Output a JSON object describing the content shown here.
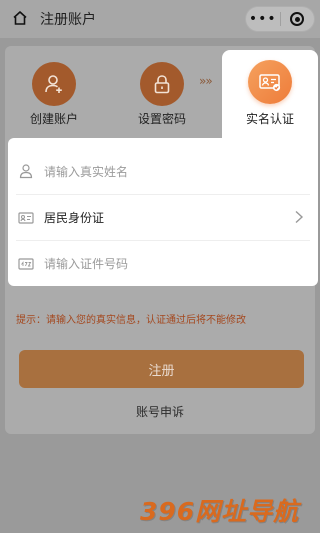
{
  "header": {
    "title": "注册账户",
    "icons": {
      "home": "home-icon",
      "more": "more-icon",
      "record": "record-icon"
    }
  },
  "steps": [
    {
      "label": "创建账户",
      "icon": "user-add-icon",
      "state": "done"
    },
    {
      "label": "设置密码",
      "icon": "lock-icon",
      "state": "done"
    },
    {
      "label": "实名认证",
      "icon": "id-card-verified-icon",
      "state": "active"
    }
  ],
  "step_separator": "»»",
  "form": {
    "name_placeholder": "请输入真实姓名",
    "id_type_value": "居民身份证",
    "id_number_placeholder": "请输入证件号码"
  },
  "hint": "提示：请输入您的真实信息，认证通过后将不能修改",
  "register_label": "注册",
  "appeal_label": "账号申诉",
  "watermark": "396网址导航",
  "colors": {
    "accent": "#ee7c3a",
    "hint": "#a4481f",
    "overlay": "#9a9a9a"
  }
}
